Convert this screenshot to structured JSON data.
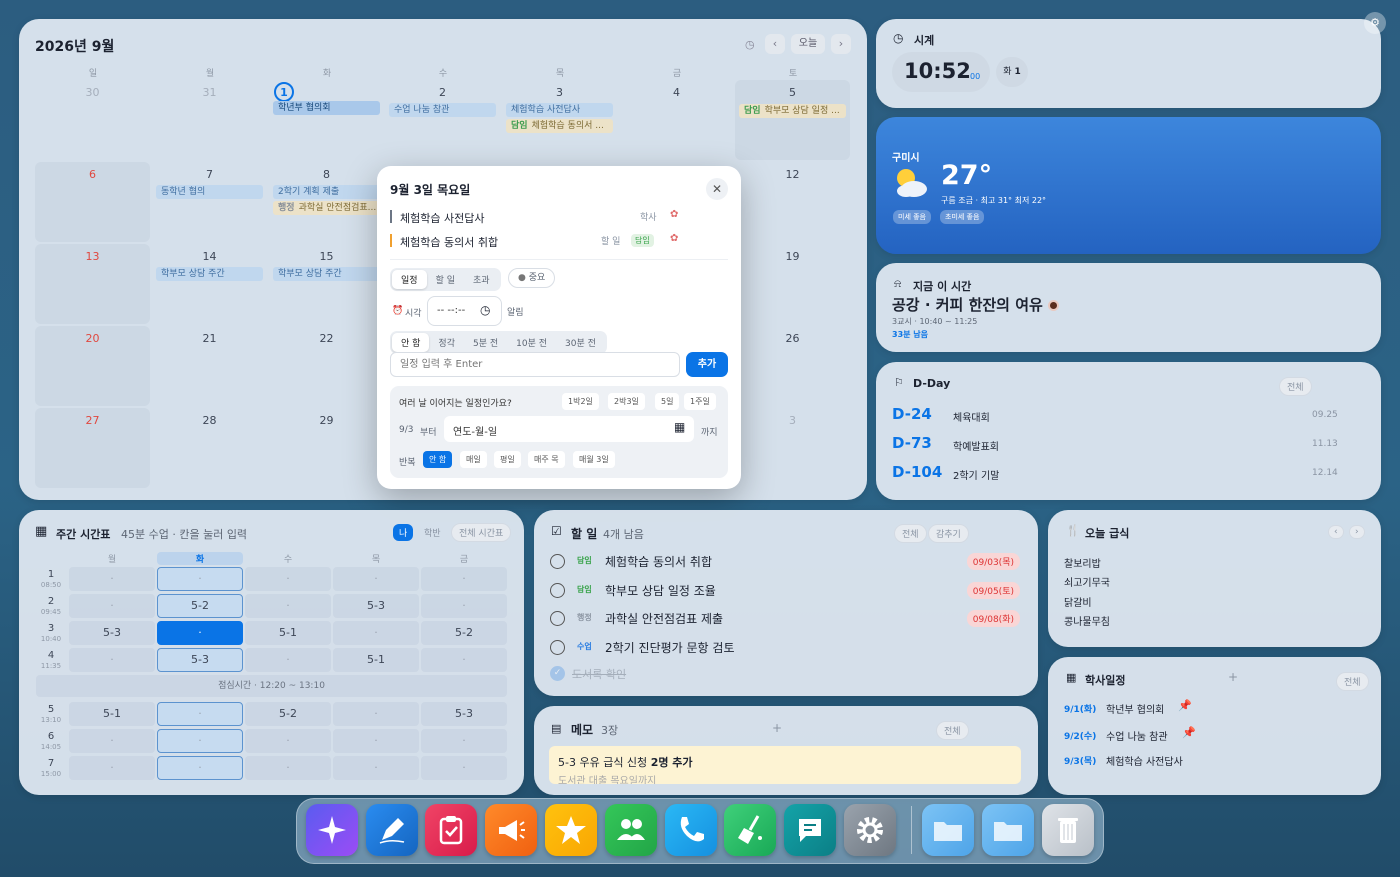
{
  "calendar": {
    "title": "2026년 9월",
    "today_btn": "오늘",
    "prev": "‹",
    "next": "›",
    "dows": [
      "일",
      "월",
      "화",
      "수",
      "목",
      "금",
      "토"
    ],
    "days": {
      "d30": "30",
      "d31": "31",
      "d1": "1",
      "d2": "2",
      "d3": "3",
      "d4": "4",
      "d5": "5",
      "d6": "6",
      "d7": "7",
      "d8": "8",
      "d12": "12",
      "d13": "13",
      "d14": "14",
      "d15": "15",
      "d19": "19",
      "d20": "20",
      "d21": "21",
      "d22": "22",
      "d26": "26",
      "d27": "27",
      "d28": "28",
      "d29": "29",
      "dn3": "3"
    },
    "events": {
      "e1": "학년부 협의회",
      "e2": "수업 나눔 참관",
      "e3a": "체험학습 사전답사",
      "e3b_tag": "담임",
      "e3b": "체험학습 동의서 ...",
      "e5_tag": "담임",
      "e5": "학부모 상담 일정 ...",
      "e7": "동학년 협의",
      "e8a": "2학기 계획 제출",
      "e8b_tag": "행정",
      "e8b": "과학실 안전점검표...",
      "e14": "학부모 상담 주간",
      "e15": "학부모 상담 주간"
    }
  },
  "popup": {
    "title": "9월 3일 목요일",
    "item1": "체험학습 사전답사",
    "item1_cat": "학사",
    "item2": "체험학습 동의서 취합",
    "item2_cat": "할 일",
    "item2_tag": "담임",
    "tabs": [
      "일정",
      "할 일",
      "초과"
    ],
    "important": "중요",
    "time_label": "시각",
    "time_value": "-- --:--",
    "alarm_label": "알림",
    "alarm_opts": [
      "안 함",
      "정각",
      "5분 전",
      "10분 전",
      "30분 전"
    ],
    "input_placeholder": "일정 입력 후 Enter",
    "add_btn": "추가",
    "multi_q": "여러 날 이어지는 일정인가요?",
    "multi_opts": [
      "1박2일",
      "2박3일",
      "5일",
      "1주일"
    ],
    "from_date": "9/3",
    "from_label": "부터",
    "to_placeholder": "연도-월-일",
    "to_label": "까지",
    "repeat_label": "반복",
    "repeat_opts": [
      "안 함",
      "매일",
      "평일",
      "매주 목",
      "매월 3일"
    ]
  },
  "clock": {
    "title": "시계",
    "time": "10:52",
    "sec": "00",
    "day": "화",
    "date": "1"
  },
  "weather": {
    "city": "구미시",
    "temp": "27°",
    "desc": "구름 조금 · 최고 31° 최저 22°",
    "dust": "미세 좋음",
    "ultra": "초미세 좋음"
  },
  "now": {
    "title": "지금 이 시간",
    "activity": "공강 · 커피 한잔의 여유",
    "period": "3교시 · 10:40 ~ 11:25",
    "remain": "33분 남음"
  },
  "dday": {
    "title": "D-Day",
    "all": "전체",
    "items": [
      {
        "d": "D-24",
        "name": "체육대회",
        "date": "09.25"
      },
      {
        "d": "D-73",
        "name": "학예발표회",
        "date": "11.13"
      },
      {
        "d": "D-104",
        "name": "2학기 기말",
        "date": "12.14"
      }
    ]
  },
  "timetable": {
    "title": "주간 시간표",
    "sub": "45분 수업 · 칸을 눌러 입력",
    "tabs": [
      "나",
      "학반",
      "전체 시간표"
    ],
    "dows": [
      "월",
      "화",
      "수",
      "목",
      "금"
    ],
    "periods": [
      {
        "n": "1",
        "t": "08:50"
      },
      {
        "n": "2",
        "t": "09:45"
      },
      {
        "n": "3",
        "t": "10:40"
      },
      {
        "n": "4",
        "t": "11:35"
      },
      {
        "n": "5",
        "t": "13:10"
      },
      {
        "n": "6",
        "t": "14:05"
      },
      {
        "n": "7",
        "t": "15:00"
      }
    ],
    "rows": [
      [
        "·",
        "·",
        "·",
        "·",
        "·"
      ],
      [
        "·",
        "5-2",
        "·",
        "5-3",
        "·"
      ],
      [
        "5-3",
        "·",
        "5-1",
        "·",
        "5-2"
      ],
      [
        "·",
        "5-3",
        "·",
        "5-1",
        "·"
      ],
      [
        "5-1",
        "·",
        "5-2",
        "·",
        "5-3"
      ],
      [
        "·",
        "·",
        "·",
        "·",
        "·"
      ],
      [
        "·",
        "·",
        "·",
        "·",
        "·"
      ]
    ],
    "lunch": "점심시간 · 12:20 ~ 13:10"
  },
  "todo": {
    "title": "할 일",
    "count": "4개 남음",
    "all": "전체",
    "hide": "감추기",
    "items": [
      {
        "tag": "담임",
        "tag_color": "#38a34a",
        "text": "체험학습 동의서 취합",
        "due": "09/03(목)"
      },
      {
        "tag": "담임",
        "tag_color": "#38a34a",
        "text": "학부모 상담 일정 조율",
        "due": "09/05(토)"
      },
      {
        "tag": "행정",
        "tag_color": "#8c96a3",
        "text": "과학실 안전점검표 제출",
        "due": "09/08(화)"
      },
      {
        "tag": "수업",
        "tag_color": "#2a7de1",
        "text": "2학기 진단평가 문항 검토",
        "due": ""
      }
    ],
    "done": "도서록 확인"
  },
  "memo": {
    "title": "메모",
    "count": "3장",
    "all": "전체",
    "add": "+",
    "line1a": "5-3 우유 급식 신청 ",
    "line1b": "2명 추가",
    "line2": "도서관 대출 목요일까지"
  },
  "lunch": {
    "title": "오늘 급식",
    "prev": "‹",
    "next": "›",
    "items": [
      "찰보리밥",
      "쇠고기무국",
      "닭갈비",
      "콩나물무침"
    ]
  },
  "schedule": {
    "title": "학사일정",
    "all": "전체",
    "add": "+",
    "items": [
      {
        "date": "9/1(화)",
        "text": "학년부 협의회"
      },
      {
        "date": "9/2(수)",
        "text": "수업 나눔 참관"
      },
      {
        "date": "9/3(목)",
        "text": "체험학습 사전답사"
      }
    ]
  },
  "colors": {
    "accent": "#0a74e6",
    "sunday": "#e0483f",
    "weather_bg": "#2a71cf",
    "danger": "#d33333"
  },
  "dock": [
    "sparkle-icon",
    "pen-icon",
    "clipboard-icon",
    "megaphone-icon",
    "star-icon",
    "people-icon",
    "phone-icon",
    "broom-icon",
    "chat-icon",
    "gear-icon",
    "folder-icon",
    "folder-icon",
    "trash-icon"
  ]
}
